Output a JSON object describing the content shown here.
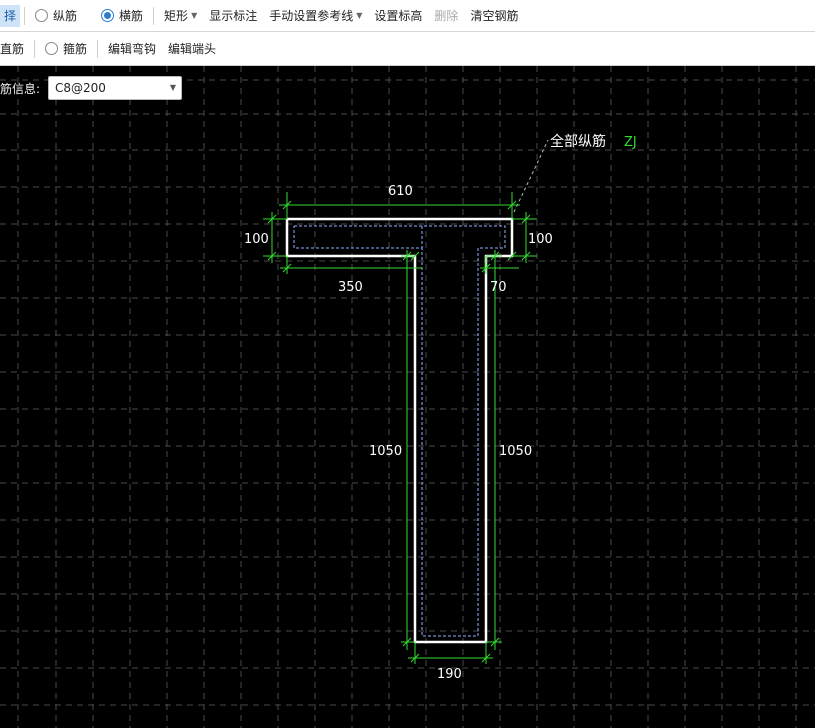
{
  "toolbar1": {
    "select_label": "择",
    "longitudinal_label": "纵筋",
    "transverse_label": "横筋",
    "rect_label": "矩形",
    "show_dims_label": "显示标注",
    "manual_ref_label": "手动设置参考线",
    "set_elevation_label": "设置标高",
    "delete_label": "删除",
    "clear_rebar_label": "清空钢筋"
  },
  "toolbar2": {
    "straight_label": "直筋",
    "stirrup_label": "箍筋",
    "edit_hook_label": "编辑弯钩",
    "edit_end_label": "编辑端头"
  },
  "rebar_info": {
    "label": "筋信息:",
    "value": "C8@200"
  },
  "drawing": {
    "all_long_label": "全部纵筋",
    "all_long_code": "ZJ",
    "dims": {
      "top_width": "610",
      "left_flange": "100",
      "right_flange": "100",
      "left_overhang": "350",
      "right_overhang": "70",
      "left_height": "1050",
      "right_height": "1050",
      "web_width": "190"
    },
    "colors": {
      "grid": "#4a4a4a",
      "outline": "#ffffff",
      "dimension": "#33dd33",
      "inner_rebar": "#8fb0ff",
      "code": "#33dd33"
    }
  }
}
